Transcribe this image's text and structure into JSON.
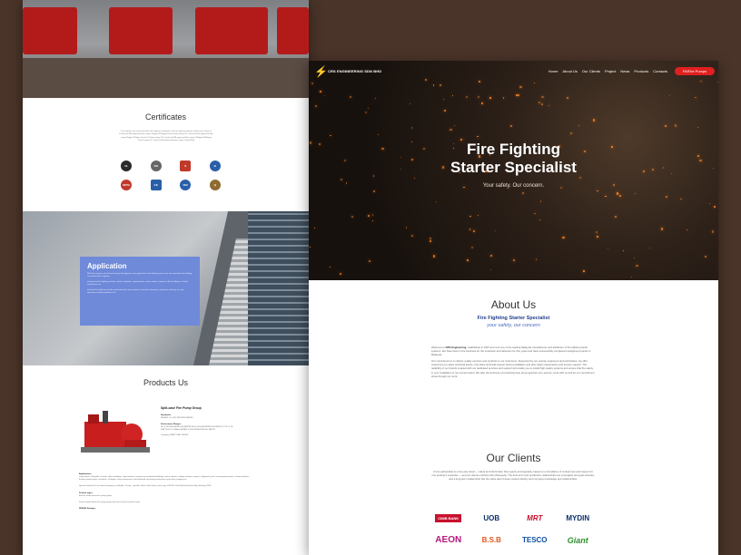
{
  "left_page": {
    "certificates": {
      "title": "Certificates",
      "text": "Our products are manufactured to the highest standards in the fire fighting industry. Split-Case Pump UL Listed and FM approved flow range 200gpm-5000gpm End Suction Pump UL Listed and FM approved flow range 50gpm-750gpm Vertical Turbine pump UL Listed and FM approved flow range 250gpm-5000gpm Diesel engine UL Listed / FM approved power range 11hp-500hp",
      "logos": [
        {
          "name": "ul-listed-logo",
          "label": "UL",
          "color": "#2b2b2b"
        },
        {
          "name": "fm-approved-logo",
          "label": "FM",
          "color": "#666666"
        },
        {
          "name": "sirim-logo",
          "label": "S",
          "color": "#c0392b"
        },
        {
          "name": "bomba-logo",
          "label": "B",
          "color": "#2a5fa8"
        },
        {
          "name": "nfpa-logo",
          "label": "NFPA",
          "color": "#c0392b"
        },
        {
          "name": "ce-logo",
          "label": "CE",
          "color": "#2a5fa8"
        },
        {
          "name": "iso-logo",
          "label": "ISO",
          "color": "#2a5fa8"
        },
        {
          "name": "gold-seal-logo",
          "label": "Q",
          "color": "#8e6b2f"
        }
      ]
    },
    "application": {
      "title": "Application",
      "para1": "With the progress of civil and industry development, the application of fire fighting pump sets has extended into building and industrial fire fighting.",
      "para2": "Commercial fire fighting includes: hotels, hospitals, supermarkets, metro stations, airports, office buildings, schools, warehouses etc.",
      "para3": "Industrial fire fighting includes: petrochemical, power plants, chemical enterprises, petroleum industry, sea port operation, offshore platforms etc."
    },
    "products": {
      "title": "Products Us",
      "name": "Split-case Fire Pump Group",
      "standards_label": "Standards:",
      "standards": "NFPA20, UL, FM, EN12845 GB6245",
      "performance_label": "Performance Ranges:",
      "performance": "UL Q:200-5000GPM H:40-380PSI FM Q:200-5000GPM H:40-380PSI CCCF Q:10-300L/S H:0.5-3.6Mpa NFPA20 Q:200-5000GPM H:40-380PSI",
      "category": "Category: FIRE PUMP GROUP",
      "applications_label": "Applications:",
      "applications": "Large hotels, Hospitals, schools, office buildings, supermarkets, commercial residential buildings, metro stations, railway stations, airports, shipyards, ports, ocean-going tankers, chemical plants, thermal power plants, terminals, oil depots, large warehouses and industrial and mining enterprises and water pumping etc.",
      "special": "Special material for sea water pumping is available: Casing - impeller, shaft, shaft sleeve, wear ring: SS2205. Seal: Mechanical packing, Bearing: NSK",
      "product_types_label": "Product types:",
      "product_types": "Electric motor driven fire pump group",
      "diesel": "Diesel engine driven fire pump group with accessory & control casing",
      "package_label": "NFPA20 Package:"
    }
  },
  "right_page": {
    "nav": {
      "logo_text": "CRS ENGINEERING SDN BHD",
      "links": [
        "Home",
        "About Us",
        "Our Clients",
        "Project",
        "News",
        "Products",
        "Contacts"
      ],
      "cta": "RNFire Pumps"
    },
    "hero": {
      "title_line1": "Fire Fighting",
      "title_line2": "Starter Specialist",
      "subtitle": "Your safety. Our concern."
    },
    "about": {
      "title": "About Us",
      "subtitle": "Fire Fighting Starter Specialist",
      "tagline": "your safety, our concern",
      "para1_prefix": "Welcome to ",
      "para1_brand": "CRS Engineering",
      "para1_rest": ", established in 1997 and now one of the leading Malaysia manufacturer and distributor of fire fighting starter systems. We have been in the business for the protection and detection for 20+ years and have successfully completed prestigious projects in Malaysia.",
      "para2": "Our commitment is to deliver quality services and products to our customers. Supported by our veteran engineers and technicians, we offer customers pre-sales technical advice, first-class technical support during installation and after sales maintenance and service support. The reliability of our brands coupled with our dedicated services and support will enable you to install high quality systems and ensure that fire safety in your installation is not compromised. We take the business of protecting lives and properties very serious: work with us and let our commitment show through our work."
    },
    "clients": {
      "title": "Our Clients",
      "text": "A true partnership is a two-way street — ideas and information flow openly and regularly, based on a foundation of mutual trust and respect for one another's expertise — and our clients embrace this philosophy. The best and most productive relationships are synergistic and goal-oriented, and a long-term relationship has the value add of deep-rooted industry and company knowledge and relationships.",
      "logos": [
        {
          "name": "cimb-bank-logo",
          "label": "CIMB BANK",
          "color": "#c8102e"
        },
        {
          "name": "uob-logo",
          "label": "UOB",
          "color": "#0b2f6b"
        },
        {
          "name": "mrt-logo",
          "label": "MRT",
          "color": "#c8102e"
        },
        {
          "name": "mydin-logo",
          "label": "MYDIN",
          "color": "#0b2f6b"
        },
        {
          "name": "aeon-logo",
          "label": "AEON",
          "color": "#b5177d"
        },
        {
          "name": "bsb-logo",
          "label": "B.S.B",
          "color": "#e0581f"
        },
        {
          "name": "tesco-logo",
          "label": "TESCO",
          "color": "#0b4fa3"
        },
        {
          "name": "giant-logo",
          "label": "Giant",
          "color": "#2f8f2f"
        }
      ]
    }
  }
}
